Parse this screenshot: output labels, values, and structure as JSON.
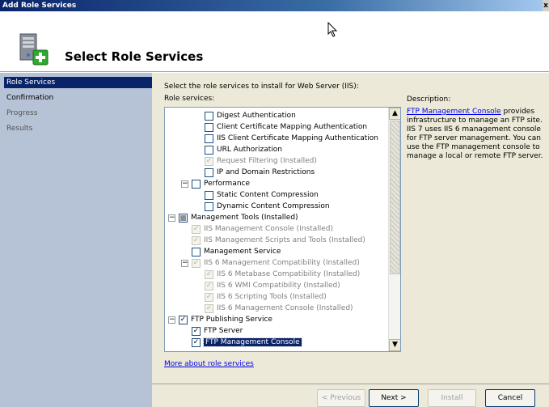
{
  "window": {
    "title": "Add Role Services",
    "close_glyph": "x"
  },
  "header": {
    "title": "Select Role Services",
    "icon": "server-add-icon"
  },
  "nav": {
    "items": [
      {
        "label": "Role Services",
        "state": "active"
      },
      {
        "label": "Confirmation",
        "state": "normal"
      },
      {
        "label": "Progress",
        "state": "dim"
      },
      {
        "label": "Results",
        "state": "dim"
      }
    ]
  },
  "main": {
    "intro": "Select the role services to install for Web Server (IIS):",
    "role_services_label": "Role services:",
    "tree": [
      {
        "label": "Digest Authentication",
        "indent": 3,
        "checked": false,
        "disabled": false
      },
      {
        "label": "Client Certificate Mapping Authentication",
        "indent": 3,
        "checked": false,
        "disabled": false
      },
      {
        "label": "IIS Client Certificate Mapping Authentication",
        "indent": 3,
        "checked": false,
        "disabled": false
      },
      {
        "label": "URL Authorization",
        "indent": 3,
        "checked": false,
        "disabled": false
      },
      {
        "label": "Request Filtering  (Installed)",
        "indent": 3,
        "checked": true,
        "disabled": true
      },
      {
        "label": "IP and Domain Restrictions",
        "indent": 3,
        "checked": false,
        "disabled": false
      },
      {
        "label": "Performance",
        "indent": 2,
        "checked": false,
        "disabled": false,
        "expander": "−"
      },
      {
        "label": "Static Content Compression",
        "indent": 3,
        "checked": false,
        "disabled": false
      },
      {
        "label": "Dynamic Content Compression",
        "indent": 3,
        "checked": false,
        "disabled": false
      },
      {
        "label": "Management Tools  (Installed)",
        "indent": 1,
        "checked": "partial",
        "disabled": false,
        "expander": "−"
      },
      {
        "label": "IIS Management Console  (Installed)",
        "indent": 2,
        "checked": true,
        "disabled": true
      },
      {
        "label": "IIS Management Scripts and Tools  (Installed)",
        "indent": 2,
        "checked": true,
        "disabled": true
      },
      {
        "label": "Management Service",
        "indent": 2,
        "checked": false,
        "disabled": false
      },
      {
        "label": "IIS 6 Management Compatibility  (Installed)",
        "indent": 2,
        "checked": true,
        "disabled": true,
        "expander": "−"
      },
      {
        "label": "IIS 6 Metabase Compatibility  (Installed)",
        "indent": 3,
        "checked": true,
        "disabled": true
      },
      {
        "label": "IIS 6 WMI Compatibility  (Installed)",
        "indent": 3,
        "checked": true,
        "disabled": true
      },
      {
        "label": "IIS 6 Scripting Tools  (Installed)",
        "indent": 3,
        "checked": true,
        "disabled": true
      },
      {
        "label": "IIS 6 Management Console  (Installed)",
        "indent": 3,
        "checked": true,
        "disabled": true
      },
      {
        "label": "FTP Publishing Service",
        "indent": 1,
        "checked": true,
        "disabled": false,
        "expander": "−"
      },
      {
        "label": "FTP Server",
        "indent": 2,
        "checked": true,
        "disabled": false
      },
      {
        "label": "FTP Management Console",
        "indent": 2,
        "checked": true,
        "disabled": false,
        "selected": true
      }
    ],
    "more_link": "More about role services"
  },
  "description": {
    "title": "Description:",
    "link": "FTP Management Console",
    "text": " provides infrastructure to manage an FTP site. IIS 7 uses IIS 6 management console for FTP server management. You can use the FTP management console to manage a local or remote FTP server."
  },
  "footer": {
    "previous": "< Previous",
    "next": "Next >",
    "install": "Install",
    "cancel": "Cancel"
  },
  "colors": {
    "accent": "#0a246a",
    "nav_bg": "#b6c2d6",
    "content_bg": "#ece9d8"
  }
}
